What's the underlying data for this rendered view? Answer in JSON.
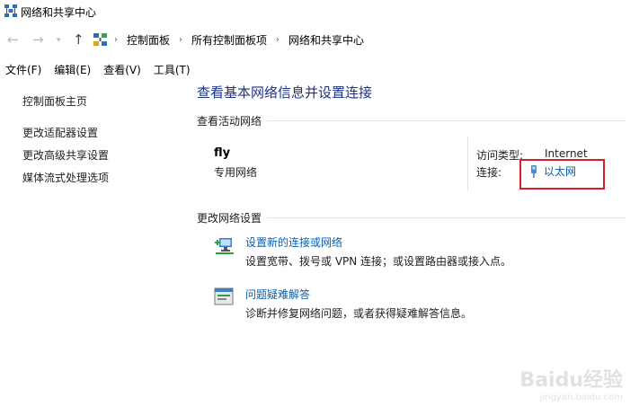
{
  "window": {
    "title": "网络和共享中心"
  },
  "address": {
    "crumbs": [
      "控制面板",
      "所有控制面板项",
      "网络和共享中心"
    ]
  },
  "menu": [
    "文件(F)",
    "编辑(E)",
    "查看(V)",
    "工具(T)"
  ],
  "sidebar": {
    "items": [
      {
        "label": "控制面板主页"
      },
      {
        "label": "更改适配器设置"
      },
      {
        "label": "更改高级共享设置"
      },
      {
        "label": "媒体流式处理选项"
      }
    ]
  },
  "main": {
    "title": "查看基本网络信息并设置连接",
    "active_section": "查看活动网络",
    "network": {
      "name": "fly",
      "type": "专用网络",
      "access_label": "访问类型:",
      "access_value": "Internet",
      "conn_label": "连接:",
      "conn_value": "以太网"
    },
    "change_section": "更改网络设置",
    "tasks": [
      {
        "link": "设置新的连接或网络",
        "desc": "设置宽带、拨号或 VPN 连接；或设置路由器或接入点。",
        "icon": "new-connection-icon"
      },
      {
        "link": "问题疑难解答",
        "desc": "诊断并修复网络问题，或者获得疑难解答信息。",
        "icon": "troubleshoot-icon"
      }
    ]
  },
  "watermark": {
    "text": "Baidu经验",
    "sub": "jingyan.baidu.com"
  },
  "colors": {
    "title_blue": "#1e3287",
    "link_blue": "#0a5fb4",
    "highlight_red": "#d4202a"
  }
}
